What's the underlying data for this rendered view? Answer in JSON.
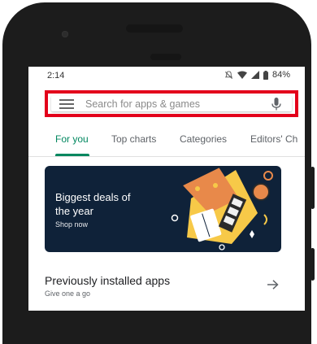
{
  "status_bar": {
    "time": "2:14",
    "battery": "84%"
  },
  "search": {
    "placeholder": "Search for apps & games"
  },
  "tabs": [
    {
      "label": "For you",
      "active": true
    },
    {
      "label": "Top charts",
      "active": false
    },
    {
      "label": "Categories",
      "active": false
    },
    {
      "label": "Editors' Ch",
      "active": false
    }
  ],
  "banner": {
    "title": "Biggest deals of the year",
    "cta": "Shop now"
  },
  "section": {
    "title": "Previously installed apps",
    "subtitle": "Give one a go"
  },
  "colors": {
    "accent": "#01875f",
    "highlight_box": "#e3001b",
    "banner_bg": "#0f2239"
  },
  "icons": [
    "hamburger-menu-icon",
    "mic-icon",
    "arrow-right-icon",
    "wifi-icon",
    "signal-icon",
    "battery-icon",
    "mute-icon"
  ]
}
